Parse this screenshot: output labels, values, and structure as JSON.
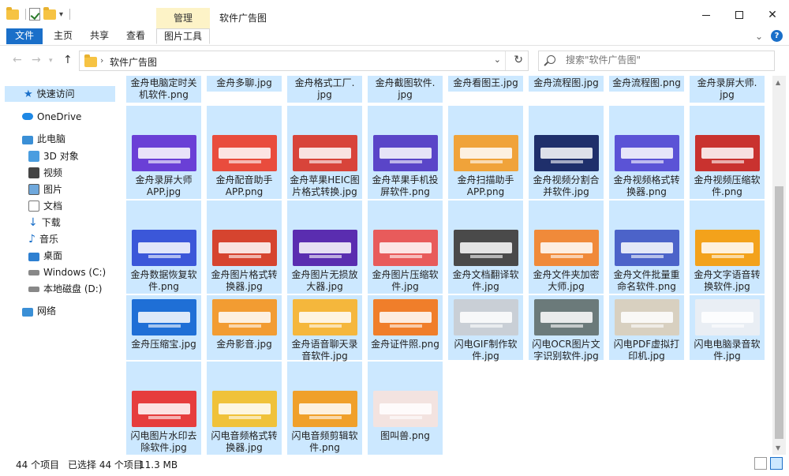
{
  "window": {
    "title": "软件广告图",
    "context_tab": "管理"
  },
  "ribbon": {
    "tabs": [
      {
        "label": "文件"
      },
      {
        "label": "主页"
      },
      {
        "label": "共享"
      },
      {
        "label": "查看"
      },
      {
        "label": "图片工具"
      }
    ]
  },
  "address": {
    "path": "软件广告图",
    "search_placeholder": "搜索\"软件广告图\""
  },
  "nav": {
    "items": [
      {
        "label": "快速访问",
        "icon": "star-icon"
      },
      {
        "label": "OneDrive",
        "icon": "cloud-icon"
      },
      {
        "label": "此电脑",
        "icon": "computer-icon"
      },
      {
        "label": "3D 对象",
        "icon": "3d-objects-icon"
      },
      {
        "label": "视频",
        "icon": "video-icon"
      },
      {
        "label": "图片",
        "icon": "picture-icon"
      },
      {
        "label": "文档",
        "icon": "document-icon"
      },
      {
        "label": "下载",
        "icon": "download-icon"
      },
      {
        "label": "音乐",
        "icon": "music-icon"
      },
      {
        "label": "桌面",
        "icon": "desktop-icon"
      },
      {
        "label": "Windows (C:)",
        "icon": "drive-icon"
      },
      {
        "label": "本地磁盘 (D:)",
        "icon": "drive-icon"
      },
      {
        "label": "网络",
        "icon": "network-icon"
      }
    ]
  },
  "files": {
    "row0": [
      {
        "line1": "金舟电脑定时关",
        "line2": "机软件.png"
      },
      {
        "line1": "金舟多聊.jpg",
        "line2": ""
      },
      {
        "line1": "金舟格式工厂.",
        "line2": "jpg"
      },
      {
        "line1": "金舟截图软件.",
        "line2": "jpg"
      },
      {
        "line1": "金舟看图王.jpg",
        "line2": ""
      },
      {
        "line1": "金舟流程图.jpg",
        "line2": ""
      },
      {
        "line1": "金舟流程图.png",
        "line2": ""
      },
      {
        "line1": "金舟录屏大师.",
        "line2": "jpg"
      }
    ],
    "row1": [
      {
        "line1": "金舟录屏大师",
        "line2": "APP.jpg",
        "color": "#6a3fd6"
      },
      {
        "line1": "金舟配音助手",
        "line2": "APP.png",
        "color": "#e94c3d"
      },
      {
        "line1": "金舟苹果HEIC图",
        "line2": "片格式转换.jpg",
        "color": "#d8443a"
      },
      {
        "line1": "金舟苹果手机投",
        "line2": "屏软件.png",
        "color": "#5a45c8"
      },
      {
        "line1": "金舟扫描助手",
        "line2": "APP.png",
        "color": "#f0a33a"
      },
      {
        "line1": "金舟视频分割合",
        "line2": "并软件.jpg",
        "color": "#1f2f6b"
      },
      {
        "line1": "金舟视频格式转",
        "line2": "换器.png",
        "color": "#5b53d6"
      },
      {
        "line1": "金舟视频压缩软",
        "line2": "件.png",
        "color": "#c9322f"
      }
    ],
    "row2": [
      {
        "line1": "金舟数据恢复软",
        "line2": "件.png",
        "color": "#3b57d9"
      },
      {
        "line1": "金舟图片格式转",
        "line2": "换器.jpg",
        "color": "#d6442f"
      },
      {
        "line1": "金舟图片无损放",
        "line2": "大器.jpg",
        "color": "#5a2db0"
      },
      {
        "line1": "金舟图片压缩软",
        "line2": "件.jpg",
        "color": "#e85b5b"
      },
      {
        "line1": "金舟文档翻译软",
        "line2": "件.jpg",
        "color": "#4a4a4a"
      },
      {
        "line1": "金舟文件夹加密",
        "line2": "大师.jpg",
        "color": "#f08a3a"
      },
      {
        "line1": "金舟文件批量重",
        "line2": "命名软件.png",
        "color": "#4c63c9"
      },
      {
        "line1": "金舟文字语音转",
        "line2": "换软件.jpg",
        "color": "#f3a21b"
      }
    ],
    "row3": [
      {
        "line1": "金舟压缩宝.jpg",
        "line2": "",
        "color": "#1f6fd6"
      },
      {
        "line1": "金舟影音.jpg",
        "line2": "",
        "color": "#f29c32"
      },
      {
        "line1": "金舟语音聊天录",
        "line2": "音软件.jpg",
        "color": "#f5b73c"
      },
      {
        "line1": "金舟证件照.png",
        "line2": "",
        "color": "#f07e2a"
      },
      {
        "line1": "闪电GIF制作软",
        "line2": "件.jpg",
        "color": "#c9cfd6"
      },
      {
        "line1": "闪电OCR图片文",
        "line2": "字识别软件.jpg",
        "color": "#6b7a7a"
      },
      {
        "line1": "闪电PDF虚拟打",
        "line2": "印机.jpg",
        "color": "#d8d0c0"
      },
      {
        "line1": "闪电电脑录音软",
        "line2": "件.jpg",
        "color": "#e9eef4"
      }
    ],
    "row4": [
      {
        "line1": "闪电图片水印去",
        "line2": "除软件.jpg",
        "color": "#e63d3d"
      },
      {
        "line1": "闪电音频格式转",
        "line2": "换器.jpg",
        "color": "#f0c23a"
      },
      {
        "line1": "闪电音频剪辑软",
        "line2": "件.png",
        "color": "#f0a02a"
      },
      {
        "line1": "图叫兽.png",
        "line2": "",
        "color": "#f3e3e0"
      }
    ]
  },
  "status": {
    "count": "44 个项目",
    "selected": "已选择 44 个项目",
    "size": "11.3 MB"
  }
}
